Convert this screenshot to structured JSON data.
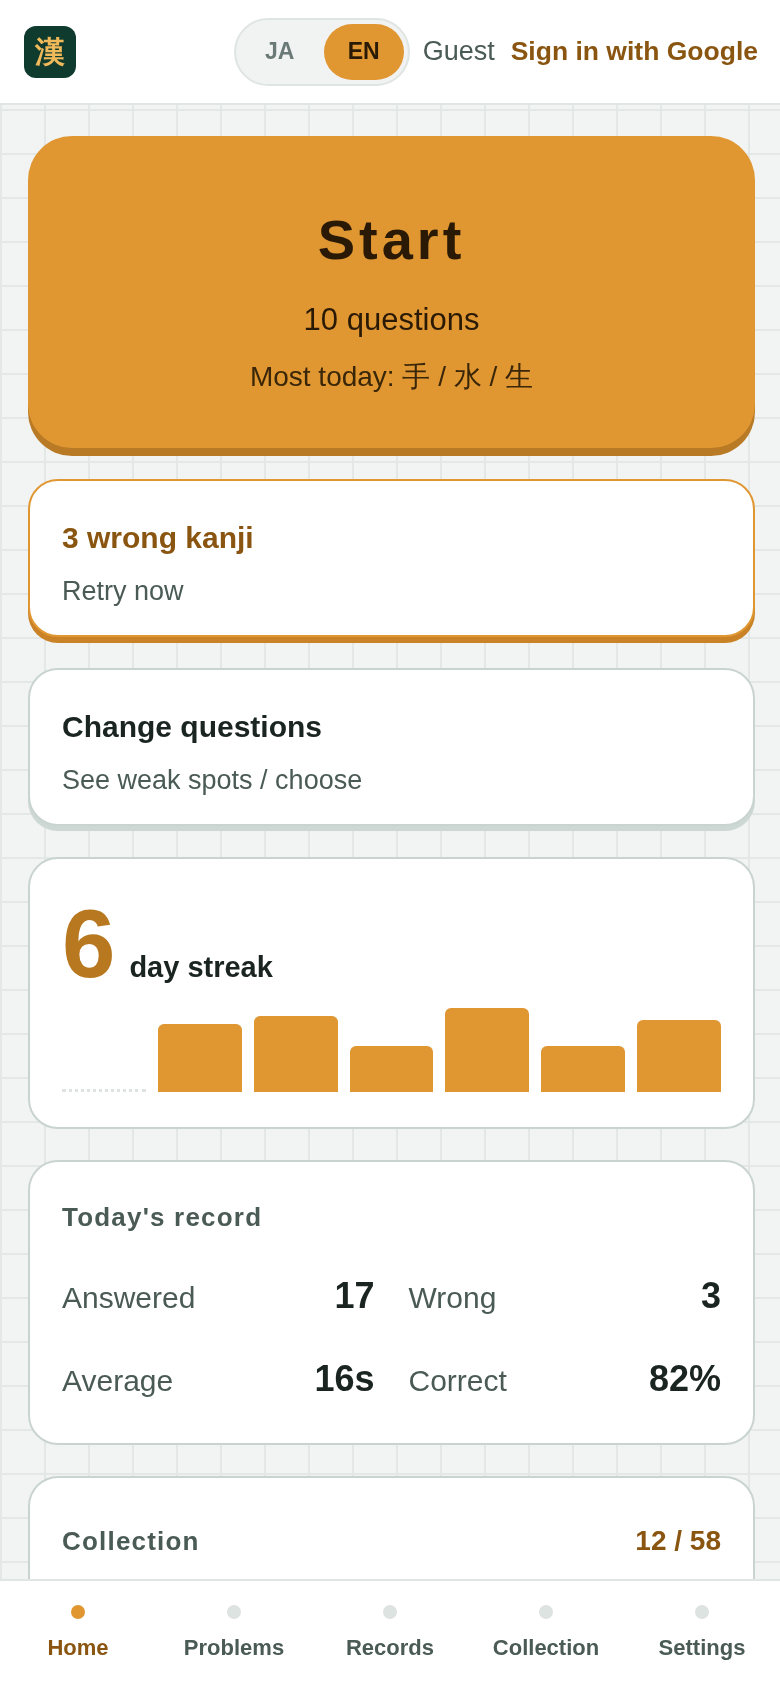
{
  "header": {
    "logo": "漢",
    "languages": [
      {
        "label": "JA",
        "selected": false
      },
      {
        "label": "EN",
        "selected": true
      }
    ],
    "user": "Guest",
    "sign_in": "Sign in with Google"
  },
  "start_card": {
    "title": "Start",
    "count": "10 questions",
    "most_today": "Most today: 手 / 水 / 生"
  },
  "action_cards": [
    {
      "kind": "alert",
      "title": "3 wrong kanji",
      "subtitle": "Retry now"
    },
    {
      "kind": "default",
      "title": "Change questions",
      "subtitle": "See weak spots / choose"
    }
  ],
  "streak": {
    "count": "6",
    "label": "day streak"
  },
  "todays_record": {
    "title": "Today's record",
    "stats": [
      {
        "label": "Answered",
        "value": "17"
      },
      {
        "label": "Wrong",
        "value": "3"
      },
      {
        "label": "Average",
        "value": "16s"
      },
      {
        "label": "Correct",
        "value": "82%"
      }
    ]
  },
  "collection": {
    "title": "Collection",
    "count": "12 / 58"
  },
  "bottom_nav": [
    {
      "label": "Home",
      "selected": true
    },
    {
      "label": "Problems",
      "selected": false
    },
    {
      "label": "Records",
      "selected": false
    },
    {
      "label": "Collection",
      "selected": false
    },
    {
      "label": "Settings",
      "selected": false
    }
  ]
}
